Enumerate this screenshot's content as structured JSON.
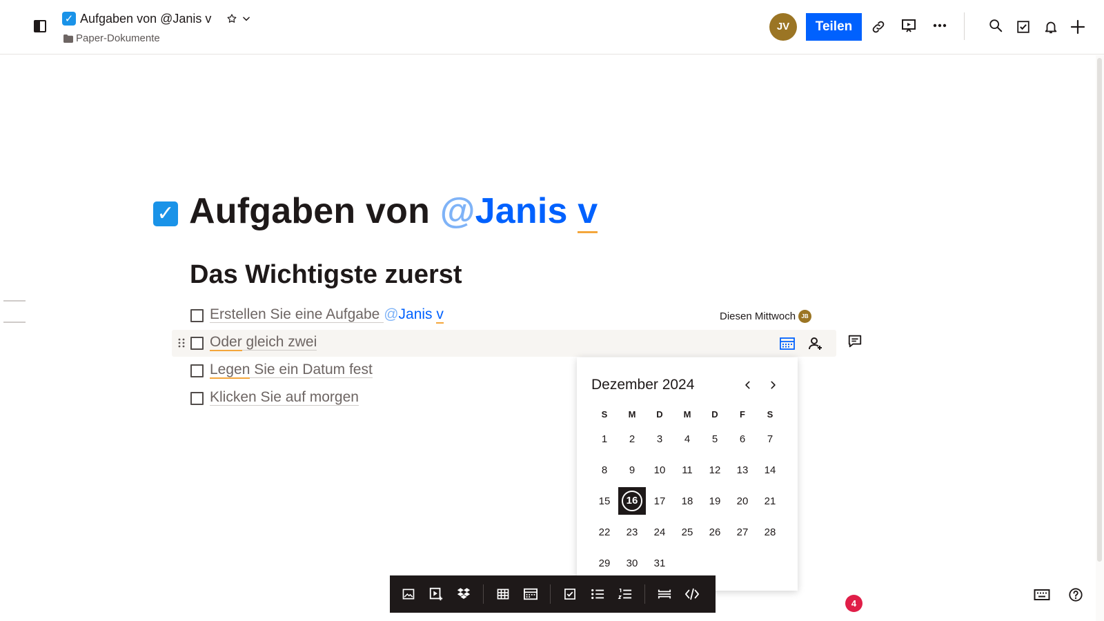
{
  "header": {
    "title": "Aufgaben von @Janis v",
    "title_emoji": "✓",
    "breadcrumb": "Paper-Dokumente",
    "avatar_initials": "JV",
    "share_label": "Teilen"
  },
  "document": {
    "title_prefix": "Aufgaben von ",
    "title_mention_at": "@",
    "title_mention_name": "Janis ",
    "title_mention_v": "v",
    "heading": "Das Wichtigste zuerst",
    "tasks": [
      {
        "text": "Erstellen Sie eine Aufgabe ",
        "mention_at": "@",
        "mention_name": "Janis ",
        "mention_v": "v",
        "due": "Diesen Mittwoch",
        "assignee_initials": "JB"
      },
      {
        "text_a": "Oder",
        "text_b": " gleich zwei"
      },
      {
        "text_a": "Legen",
        "text_b": " Sie ein Datum fest"
      },
      {
        "text": "Klicken Sie auf morgen"
      }
    ]
  },
  "datepicker": {
    "month_label": "Dezember 2024",
    "weekdays": [
      "S",
      "M",
      "D",
      "M",
      "D",
      "F",
      "S"
    ],
    "days": [
      "1",
      "2",
      "3",
      "4",
      "5",
      "6",
      "7",
      "8",
      "9",
      "10",
      "11",
      "12",
      "13",
      "14",
      "15",
      "16",
      "17",
      "18",
      "19",
      "20",
      "21",
      "22",
      "23",
      "24",
      "25",
      "26",
      "27",
      "28",
      "29",
      "30",
      "31"
    ],
    "selected_day": "16"
  },
  "notifications": {
    "count": "4"
  },
  "colors": {
    "accent": "#0061fe",
    "avatar": "#9b7524",
    "badge": "#e01e48",
    "toolbar": "#1e1919",
    "underline": "#f4a63b"
  },
  "icons": {
    "header": [
      "sidebar-toggle-icon",
      "star-icon",
      "chevron-down-icon",
      "folder-icon",
      "link-icon",
      "present-icon",
      "more-icon",
      "search-icon",
      "tasks-icon",
      "bell-icon",
      "plus-icon"
    ],
    "row": [
      "drag-handle-icon",
      "calendar-icon",
      "assign-person-icon",
      "comment-icon"
    ],
    "toolbar": [
      "image-icon",
      "video-icon",
      "dropbox-icon",
      "table-icon",
      "timeline-icon",
      "checkbox-icon",
      "bullet-list-icon",
      "numbered-list-icon",
      "divider-icon",
      "code-icon"
    ],
    "corner": [
      "keyboard-icon",
      "help-icon"
    ]
  }
}
